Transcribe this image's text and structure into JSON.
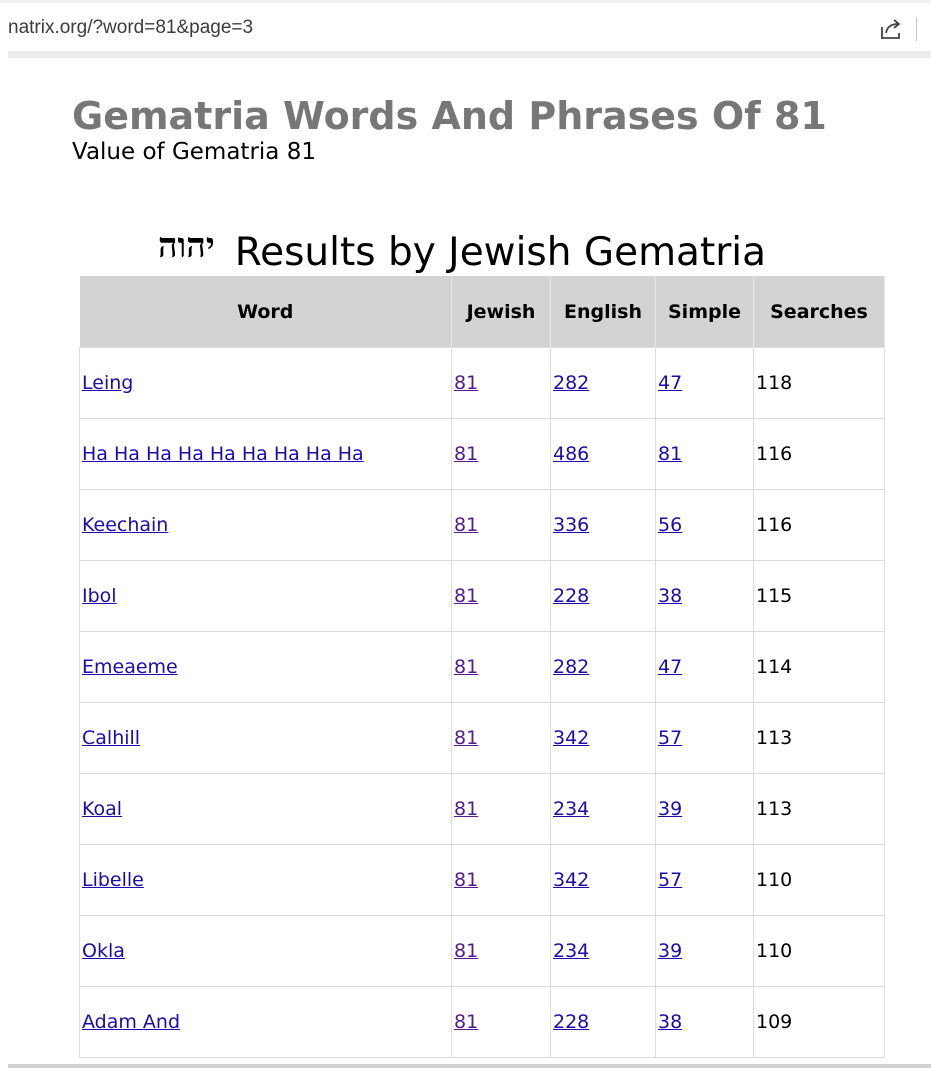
{
  "browser": {
    "url": "natrix.org/?word=81&page=3"
  },
  "header": {
    "title": "Gematria Words And Phrases Of 81",
    "subtitle": "Value of Gematria 81"
  },
  "results": {
    "hebrew_glyph": "יהוה",
    "heading": "Results by Jewish Gematria",
    "columns": [
      "Word",
      "Jewish",
      "English",
      "Simple",
      "Searches"
    ],
    "rows": [
      {
        "word": "Leing",
        "jewish": "81",
        "english": "282",
        "simple": "47",
        "searches": "118"
      },
      {
        "word": "Ha Ha Ha Ha Ha Ha Ha Ha Ha",
        "jewish": "81",
        "english": "486",
        "simple": "81",
        "searches": "116"
      },
      {
        "word": "Keechain",
        "jewish": "81",
        "english": "336",
        "simple": "56",
        "searches": "116"
      },
      {
        "word": "Ibol",
        "jewish": "81",
        "english": "228",
        "simple": "38",
        "searches": "115"
      },
      {
        "word": "Emeaeme",
        "jewish": "81",
        "english": "282",
        "simple": "47",
        "searches": "114"
      },
      {
        "word": "Calhill",
        "jewish": "81",
        "english": "342",
        "simple": "57",
        "searches": "113"
      },
      {
        "word": "Koal",
        "jewish": "81",
        "english": "234",
        "simple": "39",
        "searches": "113"
      },
      {
        "word": "Libelle",
        "jewish": "81",
        "english": "342",
        "simple": "57",
        "searches": "110"
      },
      {
        "word": "Okla",
        "jewish": "81",
        "english": "234",
        "simple": "39",
        "searches": "110"
      },
      {
        "word": "Adam And",
        "jewish": "81",
        "english": "228",
        "simple": "38",
        "searches": "109"
      }
    ]
  },
  "colors": {
    "link": "#1a0dab",
    "visited_link": "#551a8b",
    "title_gray": "#777777",
    "header_bg": "#d3d3d3"
  }
}
